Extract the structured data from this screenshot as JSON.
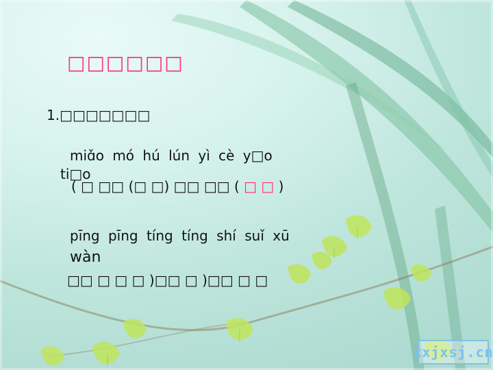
{
  "slide": {
    "title": "□□□□□□",
    "question_label": "1.□□□□□□□",
    "pinyin_line_1": "miɑ̌o  mó     hú  lún       yì   cè    y□o",
    "pinyin_line_1b": "ti□o",
    "answers_row_1": {
      "seg1": "( □   □□  (□    □)  □□  □□ ( ",
      "seg2": "□  □ ",
      "seg3": ")"
    },
    "pinyin_line_2": "pīng pīng tíng tíng  shí  suǐ    xū",
    "pinyin_line_2b": "wàn",
    "answers_row_2": {
      "seg1": "□□    □   □     □ )□□    □ )□□   □   □"
    },
    "watermark": "xxjxsj.cn"
  }
}
